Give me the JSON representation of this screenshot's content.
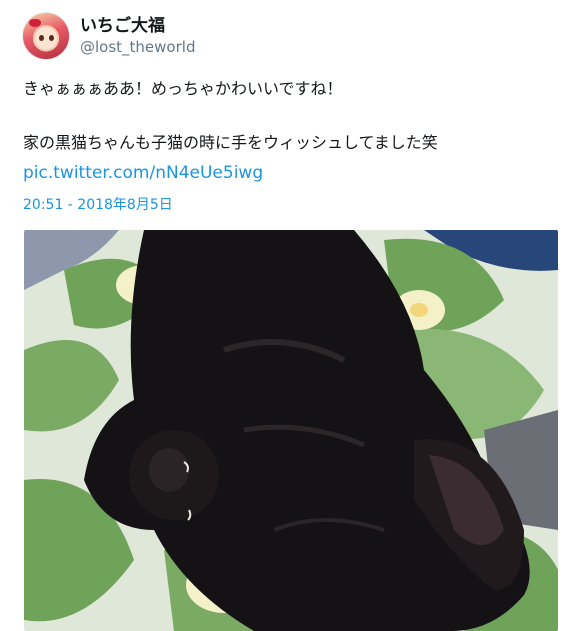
{
  "user": {
    "display_name": "いちご大福",
    "handle": "@lost_theworld",
    "avatar_icon": "anime-girl-avatar-icon"
  },
  "tweet": {
    "lines": [
      "きゃぁぁぁああ！めっちゃかわいいですね！",
      "家の黒猫ちゃんも子猫の時に手をウィッシュしてました笑"
    ],
    "link": "pic.twitter.com/nN4eUe5iwg",
    "timestamp": "20:51 - 2018年8月5日"
  },
  "photo": {
    "subject": "black-kitten-sleeping-photo",
    "colors": {
      "fabric_green": "#6fa35a",
      "fabric_light": "#e9efe2",
      "fabric_cream": "#f4f0c8",
      "cat_black": "#141214",
      "bedding_blue": "#27477a"
    }
  },
  "colors": {
    "link": "#1b95e0",
    "text": "#14171a",
    "secondary": "#657786"
  }
}
